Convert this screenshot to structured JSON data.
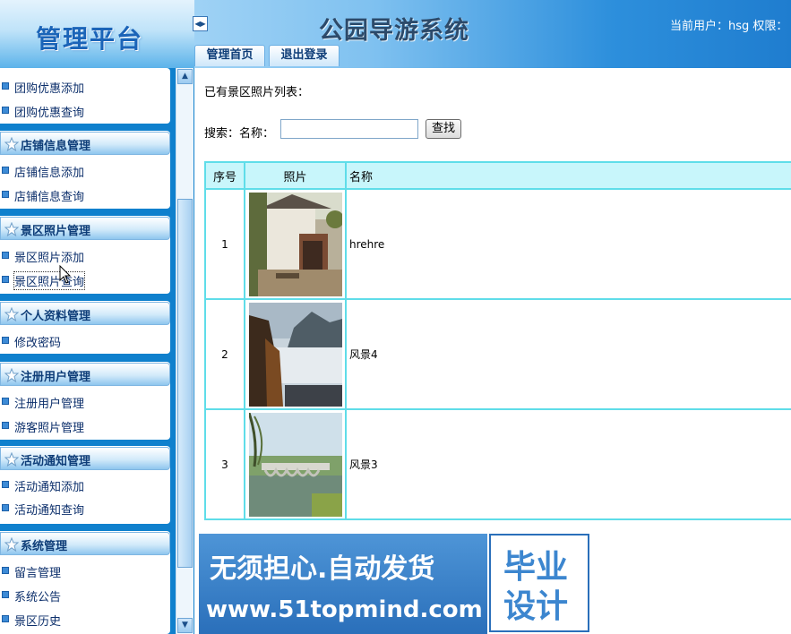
{
  "header": {
    "logo_text": "管理平台",
    "system_title": "公园导游系统",
    "user_info": "当前用户：hsg 权限：",
    "tabs": [
      "管理首页",
      "退出登录"
    ]
  },
  "sidebar": {
    "groups": [
      {
        "title": "",
        "items": [
          "团购优惠添加",
          "团购优惠查询"
        ]
      },
      {
        "title": "店铺信息管理",
        "items": [
          "店铺信息添加",
          "店铺信息查询"
        ]
      },
      {
        "title": "景区照片管理",
        "items": [
          "景区照片添加",
          "景区照片查询"
        ]
      },
      {
        "title": "个人资料管理",
        "items": [
          "修改密码"
        ]
      },
      {
        "title": "注册用户管理",
        "items": [
          "注册用户管理",
          "游客照片管理"
        ]
      },
      {
        "title": "活动通知管理",
        "items": [
          "活动通知添加",
          "活动通知查询"
        ]
      },
      {
        "title": "系统管理",
        "items": [
          "留言管理",
          "系统公告",
          "景区历史"
        ]
      }
    ]
  },
  "main": {
    "list_title": "已有景区照片列表：",
    "search": {
      "label": "搜索：名称：",
      "value": "",
      "button": "查找"
    },
    "table": {
      "headers": [
        "序号",
        "照片",
        "名称"
      ],
      "rows": [
        {
          "no": "1",
          "name": "hrehre"
        },
        {
          "no": "2",
          "name": "风景4"
        },
        {
          "no": "3",
          "name": "风景3"
        }
      ]
    }
  },
  "watermark": {
    "line1": "无须担心.自动发货",
    "line2": "www.51topmind.com",
    "right1": "毕业",
    "right2": "设计"
  },
  "colors": {
    "sidebar_bg": "#0f80cd",
    "menu_text": "#0c2f6b",
    "table_border": "#5fdde9",
    "table_header_bg": "#c8f6fb"
  }
}
